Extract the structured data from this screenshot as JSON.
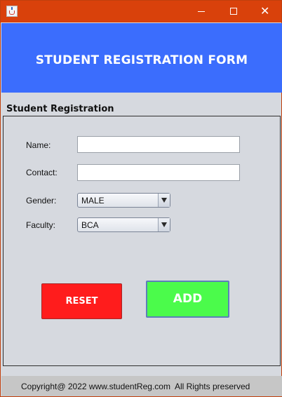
{
  "window": {
    "title": "",
    "icon": "java-cup-icon",
    "controls": {
      "minimize": "minimize-icon",
      "maximize": "maximize-icon",
      "close": "close-icon"
    },
    "titlebar_color": "#d9410b"
  },
  "header": {
    "title": "STUDENT REGISTRATION FORM",
    "background": "#3b6dfd"
  },
  "section": {
    "label": "Student Registration"
  },
  "form": {
    "name": {
      "label": "Name:",
      "value": ""
    },
    "contact": {
      "label": "Contact:",
      "value": ""
    },
    "gender": {
      "label": "Gender:",
      "selected": "MALE"
    },
    "faculty": {
      "label": "Faculty:",
      "selected": "BCA"
    }
  },
  "buttons": {
    "reset": {
      "label": "RESET",
      "color": "#ff1c1c"
    },
    "add": {
      "label": "ADD",
      "color": "#4bfb4b"
    }
  },
  "footer": {
    "text": "Copyright@ 2022 www.studentReg.com  All Rights preserved"
  }
}
